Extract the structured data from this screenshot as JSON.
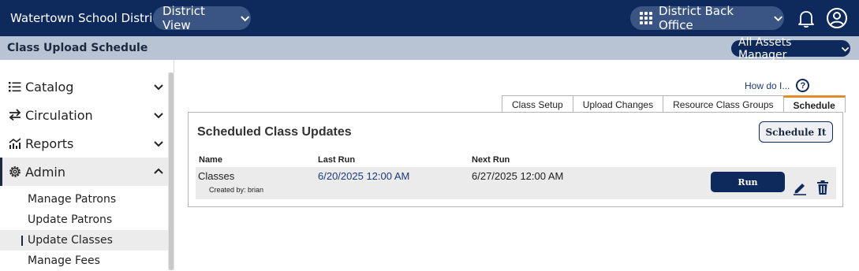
{
  "header": {
    "district_name": "Watertown School District",
    "view_selector": "District View",
    "office_selector": "District Back Office"
  },
  "subheader": {
    "page_title": "Class Upload Schedule",
    "role_selector": "All Assets Manager"
  },
  "sidebar": {
    "items": [
      {
        "label": "Catalog",
        "icon": "list-icon"
      },
      {
        "label": "Circulation",
        "icon": "swap-arrows-icon"
      },
      {
        "label": "Reports",
        "icon": "chart-icon"
      },
      {
        "label": "Admin",
        "icon": "gear-icon"
      }
    ],
    "admin_subitems": [
      {
        "label": "Manage Patrons"
      },
      {
        "label": "Update Patrons"
      },
      {
        "label": "Update Classes"
      },
      {
        "label": "Manage Fees"
      }
    ]
  },
  "help": {
    "label": "How do I...",
    "icon_text": "?"
  },
  "tabs": [
    {
      "label": "Class Setup"
    },
    {
      "label": "Upload Changes"
    },
    {
      "label": "Resource Class Groups"
    },
    {
      "label": "Schedule"
    }
  ],
  "panel": {
    "title": "Scheduled Class Updates",
    "schedule_button": "Schedule It",
    "columns": {
      "name": "Name",
      "last_run": "Last Run",
      "next_run": "Next Run"
    },
    "rows": [
      {
        "name": "Classes",
        "created_by": "Created by: brian",
        "last_run": "6/20/2025 12:00 AM",
        "next_run": "6/27/2025 12:00 AM",
        "run_button": "Run"
      }
    ]
  },
  "colors": {
    "navy": "#0e2a5c",
    "subheader": "#b8c4d4",
    "active_tab_accent": "#e38b2d",
    "link": "#1c3a7a"
  }
}
